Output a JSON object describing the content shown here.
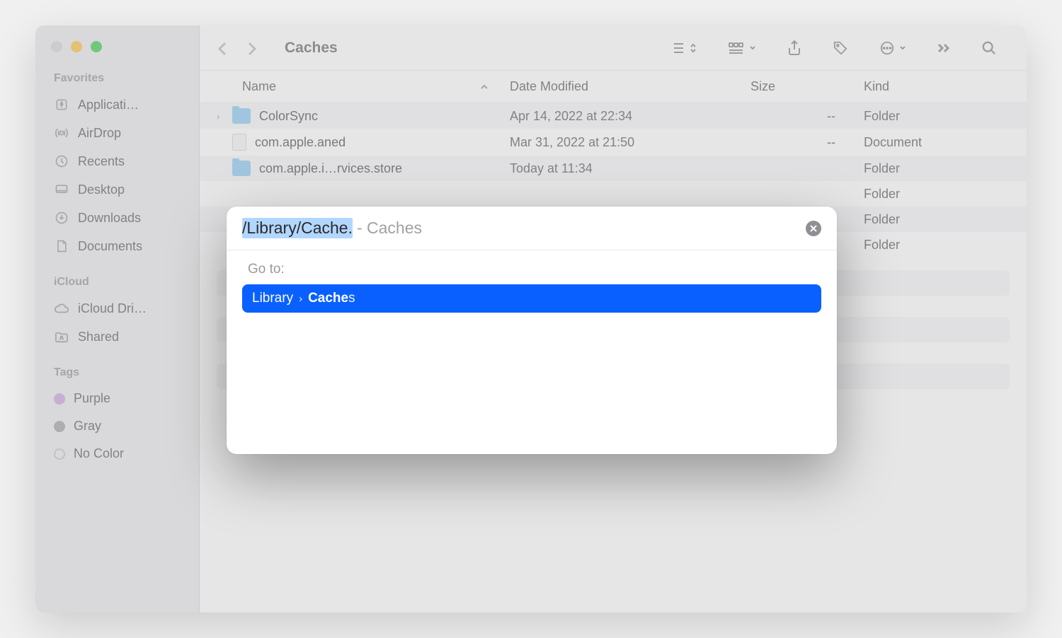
{
  "window": {
    "title": "Caches"
  },
  "sidebar": {
    "sections": [
      {
        "header": "Favorites",
        "items": [
          {
            "label": "Applicati…",
            "icon": "apps"
          },
          {
            "label": "AirDrop",
            "icon": "airdrop"
          },
          {
            "label": "Recents",
            "icon": "recents"
          },
          {
            "label": "Desktop",
            "icon": "desktop"
          },
          {
            "label": "Downloads",
            "icon": "downloads"
          },
          {
            "label": "Documents",
            "icon": "documents"
          }
        ]
      },
      {
        "header": "iCloud",
        "items": [
          {
            "label": "iCloud Dri…",
            "icon": "icloud"
          },
          {
            "label": "Shared",
            "icon": "shared"
          }
        ]
      },
      {
        "header": "Tags",
        "items": [
          {
            "label": "Purple",
            "tag": "purple"
          },
          {
            "label": "Gray",
            "tag": "gray"
          },
          {
            "label": "No Color",
            "tag": "none"
          }
        ]
      }
    ]
  },
  "columns": {
    "name": "Name",
    "date": "Date Modified",
    "size": "Size",
    "kind": "Kind"
  },
  "files": [
    {
      "expandable": true,
      "type": "folder",
      "name": "ColorSync",
      "date": "Apr 14, 2022 at 22:34",
      "size": "--",
      "kind": "Folder",
      "striped": true
    },
    {
      "expandable": false,
      "type": "doc",
      "name": "com.apple.aned",
      "date": "Mar 31, 2022 at 21:50",
      "size": "--",
      "kind": "Document",
      "striped": false
    },
    {
      "expandable": false,
      "type": "folder",
      "name": "com.apple.i…rvices.store",
      "date": "Today at 11:34",
      "size": "",
      "kind": "Folder",
      "striped": true,
      "clipped": true
    },
    {
      "expandable": false,
      "type": "",
      "name": "",
      "date": "",
      "size": "",
      "kind": "Folder",
      "striped": false,
      "hidden_left": true
    },
    {
      "expandable": false,
      "type": "",
      "name": "",
      "date": "",
      "size": "",
      "kind": "Folder",
      "striped": true,
      "hidden_left": true
    },
    {
      "expandable": false,
      "type": "",
      "name": "",
      "date": "",
      "size": "",
      "kind": "Folder",
      "striped": false,
      "hidden_left": true
    }
  ],
  "goto": {
    "typed": "/Library/Cache.",
    "suffix": "- Caches",
    "label": "Go to:",
    "suggestion": {
      "part1": "Library",
      "bold": "Cache",
      "trail": "s"
    }
  }
}
